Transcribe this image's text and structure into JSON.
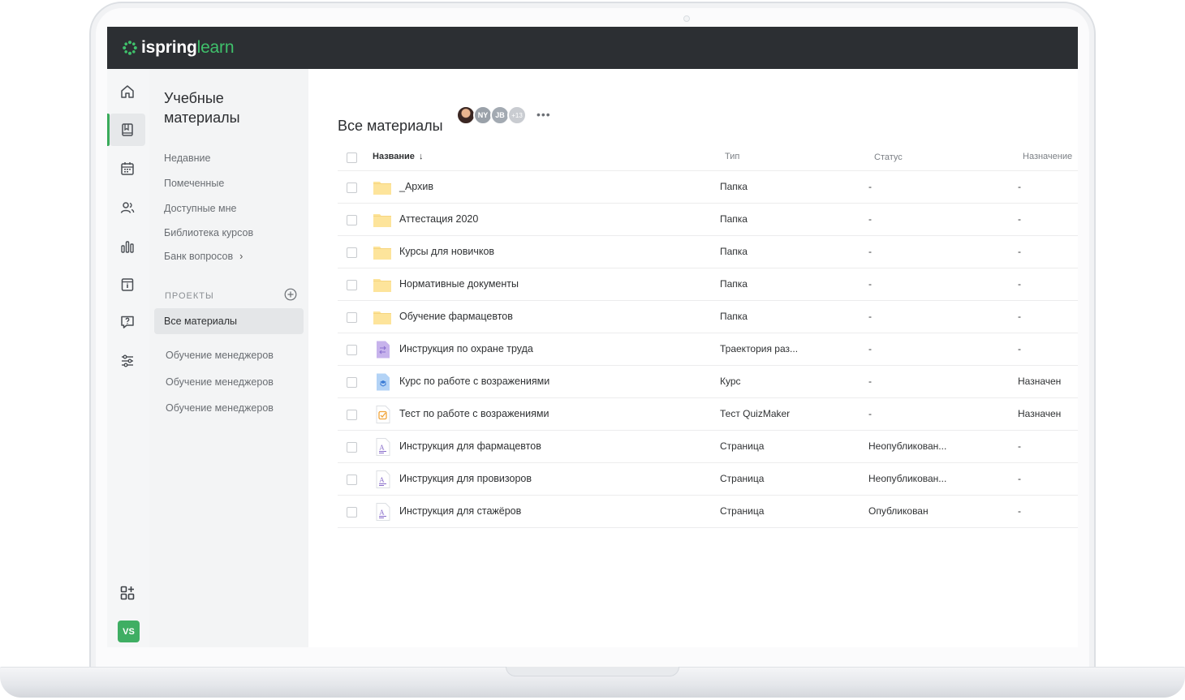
{
  "brand": {
    "name_bold": "ispring",
    "name_light": "learn",
    "accent": "#3fc06b"
  },
  "rail": {
    "items": [
      {
        "icon": "home-icon"
      },
      {
        "icon": "book-icon",
        "active": true
      },
      {
        "icon": "calendar-icon"
      },
      {
        "icon": "users-icon"
      },
      {
        "icon": "bar-chart-icon"
      },
      {
        "icon": "info-page-icon"
      },
      {
        "icon": "help-chat-icon"
      },
      {
        "icon": "sliders-icon"
      }
    ],
    "apps_icon": "apps-add-icon",
    "user_initials": "VS"
  },
  "secnav": {
    "title": "Учебные материалы",
    "links": [
      "Недавние",
      "Помеченные",
      "Доступные мне",
      "Библиотека курсов",
      "Банк вопросов"
    ],
    "projects_label": "ПРОЕКТЫ",
    "active_project": "Все материалы",
    "projects": [
      "Обучение менеджеров",
      "Обучение менеджеров",
      "Обучение менеджеров"
    ]
  },
  "main": {
    "title": "Все материалы",
    "avatars": {
      "a2": "NY",
      "a3": "JB",
      "more": "+13"
    },
    "more_menu": "•••",
    "columns": {
      "name": "Название",
      "sort_arrow": "↓",
      "type": "Тип",
      "status": "Статус",
      "assignment": "Назначение"
    },
    "rows": [
      {
        "icon": "folder-icon",
        "name": "_Архив",
        "type": "Папка",
        "status": "-",
        "assignment": "-"
      },
      {
        "icon": "folder-icon",
        "name": "Аттестация 2020",
        "type": "Папка",
        "status": "-",
        "assignment": "-"
      },
      {
        "icon": "folder-icon",
        "name": "Курсы для новичков",
        "type": "Папка",
        "status": "-",
        "assignment": "-"
      },
      {
        "icon": "folder-icon",
        "name": "Нормативные документы",
        "type": "Папка",
        "status": "-",
        "assignment": "-"
      },
      {
        "icon": "folder-icon",
        "name": "Обучение фармацевтов",
        "type": "Папка",
        "status": "-",
        "assignment": "-"
      },
      {
        "icon": "trajectory-icon",
        "name": "Инструкция по охране труда",
        "type": "Траектория раз...",
        "status": "-",
        "assignment": "-"
      },
      {
        "icon": "course-icon",
        "name": "Курс по работе с возражениями",
        "type": "Курс",
        "status": "-",
        "assignment": "Назначен"
      },
      {
        "icon": "quiz-icon",
        "name": "Тест по работе с возражениями",
        "type": "Тест QuizMaker",
        "status": "-",
        "assignment": "Назначен"
      },
      {
        "icon": "page-icon",
        "name": "Инструкция для фармацевтов",
        "type": "Страница",
        "status": "Неопубликован...",
        "assignment": "-"
      },
      {
        "icon": "page-icon",
        "name": "Инструкция для провизоров",
        "type": "Страница",
        "status": "Неопубликован...",
        "assignment": "-"
      },
      {
        "icon": "page-icon",
        "name": "Инструкция для стажёров",
        "type": "Страница",
        "status": "Опубликован",
        "assignment": "-"
      }
    ]
  }
}
